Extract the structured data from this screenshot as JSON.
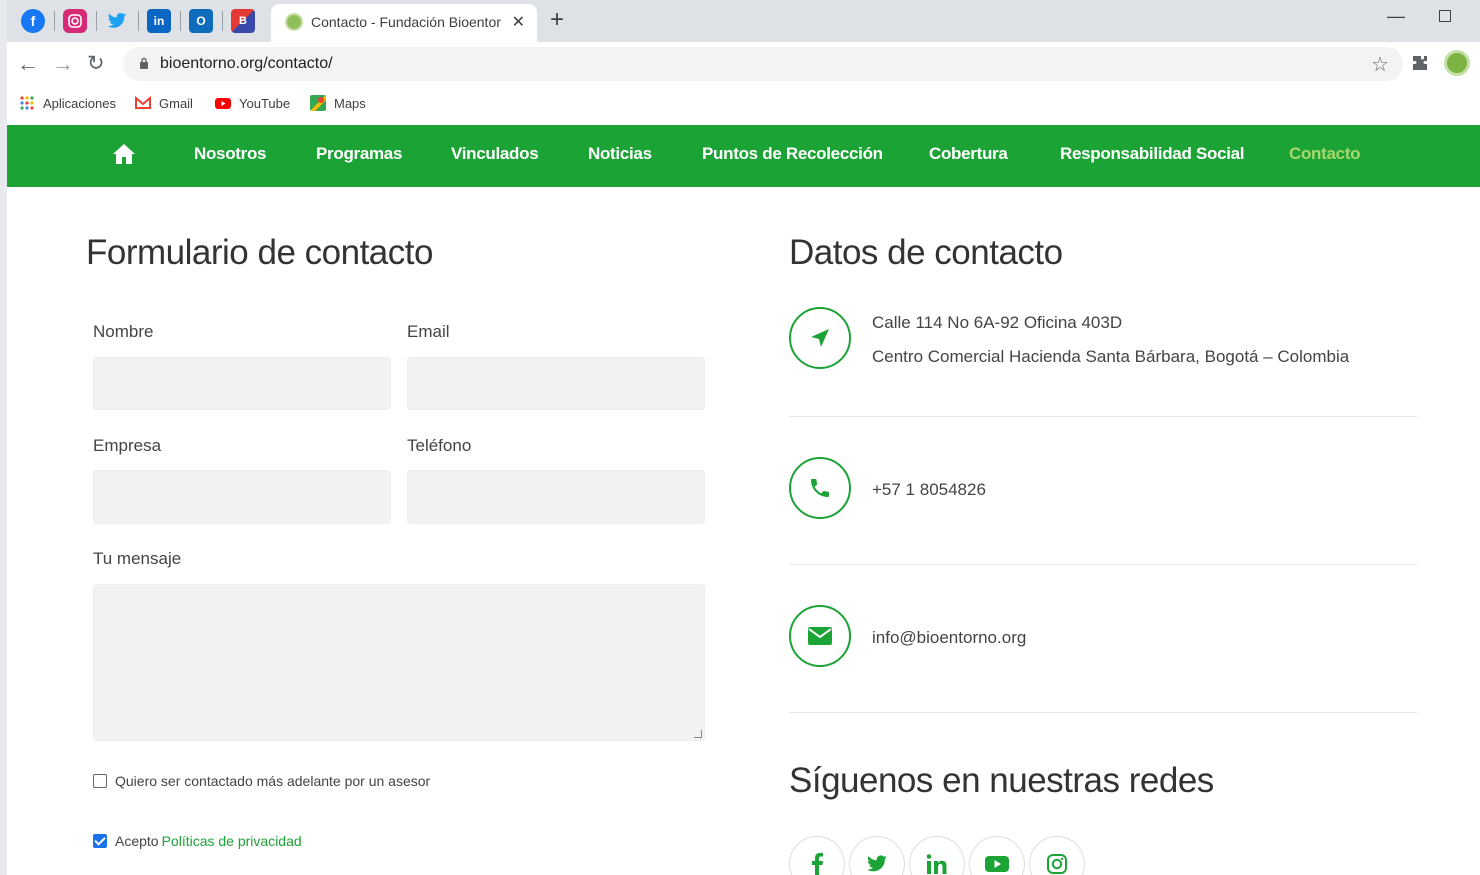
{
  "browser": {
    "pinned_tabs": [
      "facebook-icon",
      "instagram-icon",
      "twitter-icon",
      "linkedin-icon",
      "outlook-icon",
      "app-icon"
    ],
    "active_tab_title": "Contacto - Fundación Bioentorno",
    "url": "bioentorno.org/contacto/",
    "bookmarks": [
      {
        "label": "Aplicaciones"
      },
      {
        "label": "Gmail"
      },
      {
        "label": "YouTube"
      },
      {
        "label": "Maps"
      }
    ]
  },
  "nav": {
    "items": [
      "Nosotros",
      "Programas",
      "Vinculados",
      "Noticias",
      "Puntos de Recolección",
      "Cobertura",
      "Responsabilidad Social",
      "Contacto"
    ],
    "active": "Contacto"
  },
  "form": {
    "title": "Formulario de contacto",
    "nombre_label": "Nombre",
    "email_label": "Email",
    "empresa_label": "Empresa",
    "telefono_label": "Teléfono",
    "mensaje_label": "Tu mensaje",
    "contact_later_label": "Quiero ser contactado más adelante por un asesor",
    "accept_prefix": "Acepto",
    "privacy_link": "Políticas de privacidad",
    "contact_later_checked": false,
    "privacy_checked": true
  },
  "contact": {
    "title": "Datos de contacto",
    "address_line1": "Calle 114 No 6A-92 Oficina 403D",
    "address_line2": "Centro Comercial Hacienda Santa Bárbara, Bogotá – Colombia",
    "phone": "+57 1 8054826",
    "email": "info@bioentorno.org"
  },
  "social": {
    "title": "Síguenos en nuestras redes",
    "networks": [
      "facebook",
      "twitter",
      "linkedin",
      "youtube",
      "instagram"
    ]
  },
  "colors": {
    "brand_green": "#1ca336",
    "nav_active": "#a8d86a"
  }
}
